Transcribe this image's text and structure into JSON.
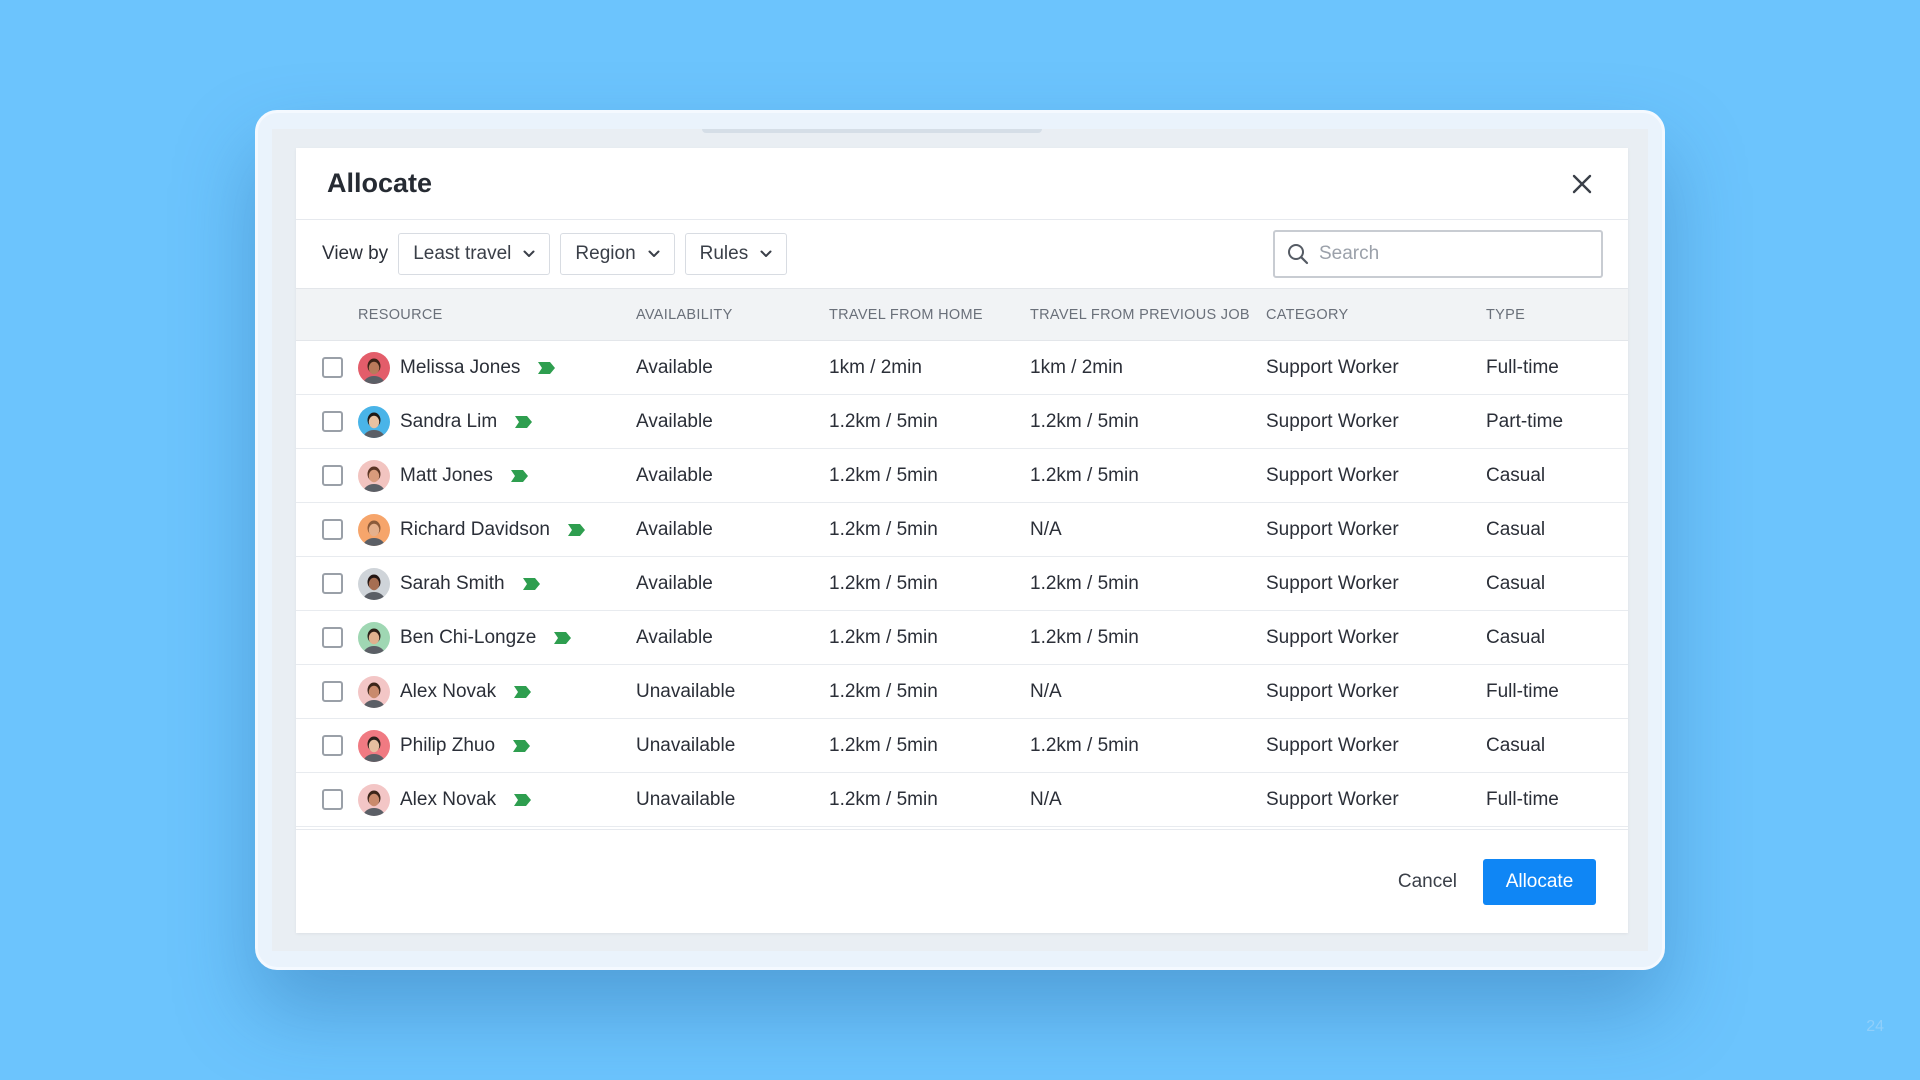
{
  "modal": {
    "title": "Allocate",
    "close_icon": "close-icon"
  },
  "toolbar": {
    "view_by_label": "View by",
    "dropdowns": [
      {
        "label": "Least travel",
        "icon": "chevron-down-icon"
      },
      {
        "label": "Region",
        "icon": "chevron-down-icon"
      },
      {
        "label": "Rules",
        "icon": "chevron-down-icon"
      }
    ],
    "search": {
      "placeholder": "Search",
      "value": "",
      "icon": "search-icon"
    }
  },
  "table": {
    "columns": [
      "Resource",
      "Availability",
      "Travel from home",
      "Travel from previous job",
      "Category",
      "Type"
    ],
    "rows": [
      {
        "name": "Melissa Jones",
        "availability": "Available",
        "home": "1km / 2min",
        "previous": "1km / 2min",
        "category": "Support Worker",
        "type": "Full-time",
        "avatar_bg": "#e35d6a",
        "skin": "#b97a5a",
        "hair": "#3a2216"
      },
      {
        "name": "Sandra Lim",
        "availability": "Available",
        "home": "1.2km / 5min",
        "previous": "1.2km / 5min",
        "category": "Support Worker",
        "type": "Part-time",
        "avatar_bg": "#49b4e8",
        "skin": "#e7c1a1",
        "hair": "#1d1815"
      },
      {
        "name": "Matt Jones",
        "availability": "Available",
        "home": "1.2km / 5min",
        "previous": "1.2km / 5min",
        "category": "Support Worker",
        "type": "Casual",
        "avatar_bg": "#f2c4c0",
        "skin": "#d99b7c",
        "hair": "#5a3524"
      },
      {
        "name": "Richard Davidson",
        "availability": "Available",
        "home": "1.2km / 5min",
        "previous": "N/A",
        "category": "Support Worker",
        "type": "Casual",
        "avatar_bg": "#f6a56b",
        "skin": "#e5b08c",
        "hair": "#8a5a3a"
      },
      {
        "name": "Sarah Smith",
        "availability": "Available",
        "home": "1.2km / 5min",
        "previous": "1.2km / 5min",
        "category": "Support Worker",
        "type": "Casual",
        "avatar_bg": "#cfd4d9",
        "skin": "#a66e52",
        "hair": "#221512"
      },
      {
        "name": "Ben Chi-Longze",
        "availability": "Available",
        "home": "1.2km / 5min",
        "previous": "1.2km / 5min",
        "category": "Support Worker",
        "type": "Casual",
        "avatar_bg": "#9fd7b3",
        "skin": "#e0b18e",
        "hair": "#2b1e16"
      },
      {
        "name": "Alex Novak",
        "availability": "Unavailable",
        "home": "1.2km / 5min",
        "previous": "N/A",
        "category": "Support Worker",
        "type": "Full-time",
        "avatar_bg": "#f3c6c6",
        "skin": "#c98a6c",
        "hair": "#3b2519"
      },
      {
        "name": "Philip Zhuo",
        "availability": "Unavailable",
        "home": "1.2km / 5min",
        "previous": "1.2km / 5min",
        "category": "Support Worker",
        "type": "Casual",
        "avatar_bg": "#f07a82",
        "skin": "#e7bfa0",
        "hair": "#2a201a"
      },
      {
        "name": "Alex Novak",
        "availability": "Unavailable",
        "home": "1.2km / 5min",
        "previous": "N/A",
        "category": "Support Worker",
        "type": "Full-time",
        "avatar_bg": "#f3c6c6",
        "skin": "#c98a6c",
        "hair": "#3b2519"
      }
    ],
    "flag_icon": "green-flag-icon",
    "flag_color": "#2e9e4f"
  },
  "footer": {
    "cancel_label": "Cancel",
    "allocate_label": "Allocate",
    "primary_color": "#0f86f5"
  },
  "page_number": "24"
}
